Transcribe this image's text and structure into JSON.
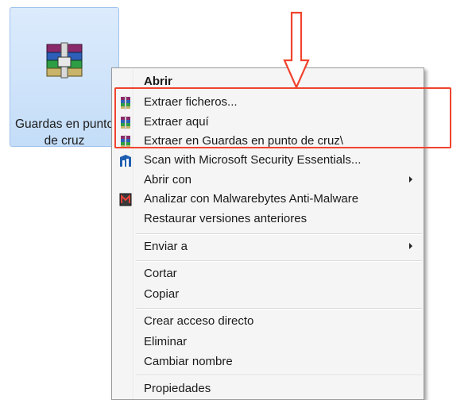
{
  "desktop_icon": {
    "label_line1": "Guardas en punto",
    "label_line2": "de cruz",
    "icon": "winrar-archive-icon"
  },
  "context_menu": {
    "items": [
      {
        "label": "Abrir",
        "icon": "",
        "bold": true
      },
      {
        "label": "Extraer ficheros...",
        "icon": "winrar-icon"
      },
      {
        "label": "Extraer aquí",
        "icon": "winrar-icon"
      },
      {
        "label": "Extraer en Guardas en punto de cruz\\",
        "icon": "winrar-icon"
      },
      {
        "label": "Scan with Microsoft Security Essentials...",
        "icon": "security-essentials-icon"
      },
      {
        "label": "Abrir con",
        "icon": "",
        "submenu": true
      },
      {
        "label": "Analizar con Malwarebytes Anti-Malware",
        "icon": "malwarebytes-icon"
      },
      {
        "label": "Restaurar versiones anteriores",
        "icon": ""
      },
      {
        "label": "Enviar a",
        "icon": "",
        "submenu": true
      },
      {
        "label": "Cortar",
        "icon": ""
      },
      {
        "label": "Copiar",
        "icon": ""
      },
      {
        "label": "Crear acceso directo",
        "icon": ""
      },
      {
        "label": "Eliminar",
        "icon": ""
      },
      {
        "label": "Cambiar nombre",
        "icon": ""
      },
      {
        "label": "Propiedades",
        "icon": ""
      }
    ]
  },
  "annotation": {
    "highlight_color": "#f0432e",
    "arrow": "down-arrow-annotation"
  }
}
